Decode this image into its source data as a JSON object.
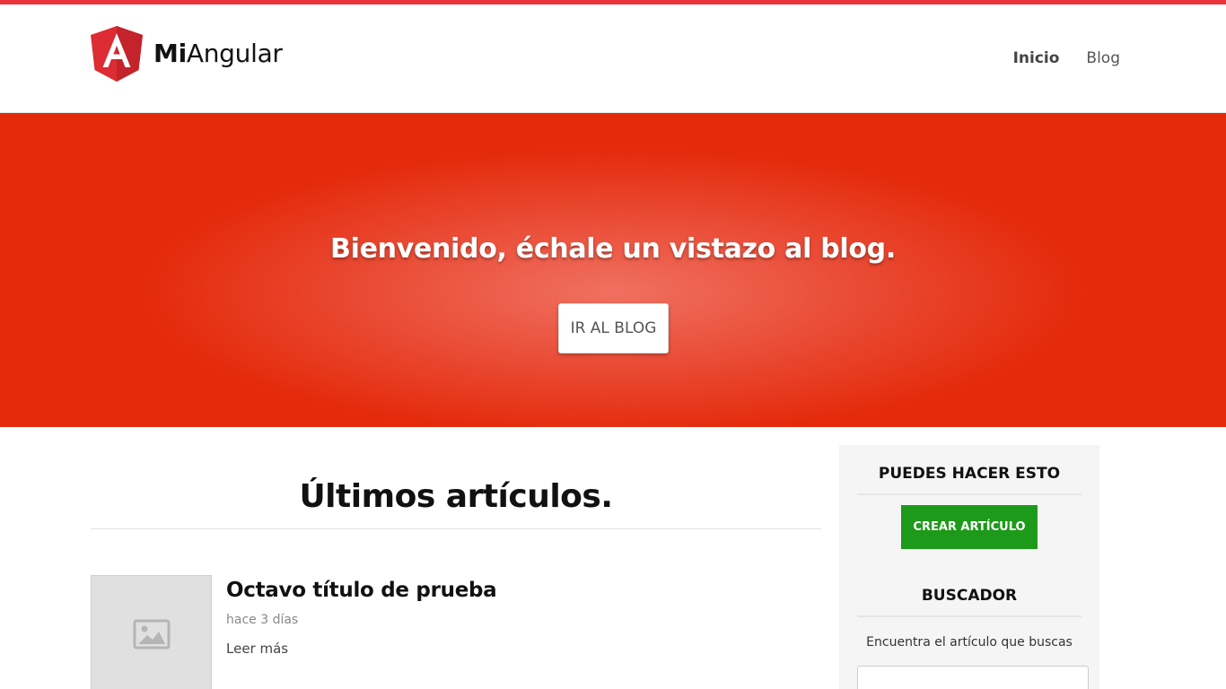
{
  "colors": {
    "brand_red": "#e8333a",
    "hero_red": "#e42a0a",
    "action_green": "#1e9a1a",
    "sidebar_bg": "#f5f5f5",
    "thumb_gray": "#e0e0e0"
  },
  "brand": {
    "logo_icon": "angular-icon",
    "name_bold": "Mi",
    "name_light": "Angular"
  },
  "nav": {
    "items": [
      {
        "label": "Inicio",
        "active": true
      },
      {
        "label": "Blog",
        "active": false
      }
    ]
  },
  "hero": {
    "title": "Bienvenido, échale un vistazo al blog.",
    "button_label": "IR AL BLOG"
  },
  "main": {
    "title": "Últimos artículos.",
    "articles": [
      {
        "thumbnail_icon": "image-placeholder-icon",
        "title": "Octavo título de prueba",
        "date": "hace 3 días",
        "link_label": "Leer más"
      }
    ]
  },
  "sidebar": {
    "actions_heading": "PUEDES HACER ESTO",
    "create_button_label": "CREAR ARTÍCULO",
    "search_heading": "BUSCADOR",
    "search_text": "Encuentra el artículo que buscas",
    "search_value": ""
  }
}
